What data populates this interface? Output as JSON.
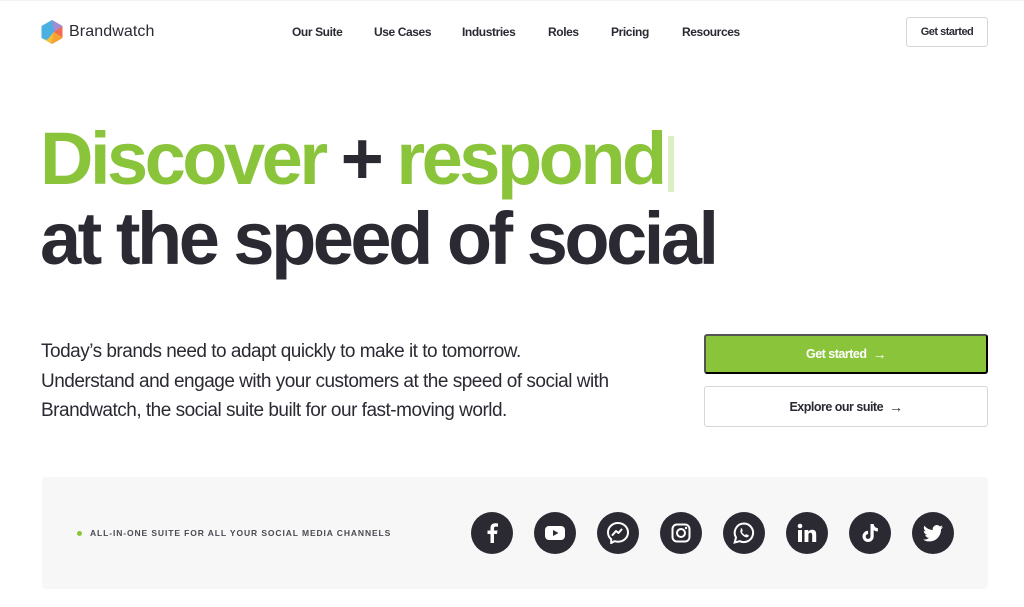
{
  "brand": {
    "name": "Brandwatch",
    "logo_icon": "hexagon-logo-icon",
    "colors": {
      "accent": "#89c43b",
      "text": "#2b2a33",
      "panel": "#f7f7f7"
    }
  },
  "nav": {
    "items": [
      {
        "label": "Our Suite"
      },
      {
        "label": "Use Cases"
      },
      {
        "label": "Industries"
      },
      {
        "label": "Roles"
      },
      {
        "label": "Pricing"
      },
      {
        "label": "Resources"
      }
    ],
    "cta_label": "Get started"
  },
  "hero": {
    "headline_word1": "Discover",
    "headline_plus": "+",
    "headline_word2": "respond",
    "headline_line2": "at the speed of social",
    "lede_lines": [
      "Today’s brands need to adapt quickly to make it to tomorrow.",
      "Understand and engage with your customers at the speed of social with",
      "Brandwatch, the social suite built for our fast-moving world."
    ],
    "primary_cta": {
      "label": "Get started",
      "icon": "→"
    },
    "secondary_cta": {
      "label": "Explore our suite",
      "icon": "→"
    }
  },
  "channels": {
    "label": "ALL-IN-ONE SUITE FOR ALL YOUR SOCIAL MEDIA CHANNELS",
    "icons": [
      "facebook-icon",
      "youtube-icon",
      "messenger-icon",
      "instagram-icon",
      "whatsapp-icon",
      "linkedin-icon",
      "tiktok-icon",
      "twitter-icon"
    ]
  }
}
